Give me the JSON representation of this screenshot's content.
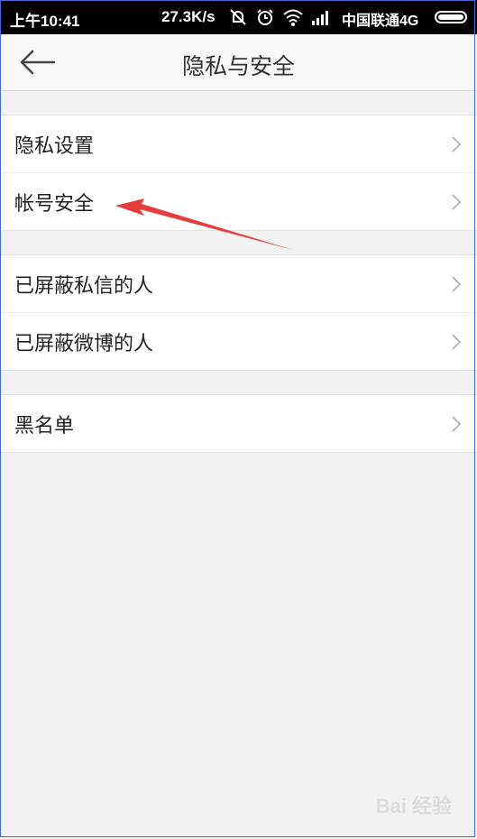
{
  "status_bar": {
    "time": "上午10:41",
    "speed": "27.3K/s",
    "carrier": "中国联通4G"
  },
  "header": {
    "title": "隐私与安全"
  },
  "groups": [
    {
      "items": [
        {
          "label": "隐私设置"
        },
        {
          "label": "帐号安全"
        }
      ]
    },
    {
      "items": [
        {
          "label": "已屏蔽私信的人"
        },
        {
          "label": "已屏蔽微博的人"
        }
      ]
    },
    {
      "items": [
        {
          "label": "黑名单"
        }
      ]
    }
  ],
  "annotation": {
    "arrow_color": "#e83b3b"
  },
  "watermark": {
    "text": "Bai 经验"
  },
  "colors": {
    "background": "#f2f2f2",
    "status_bar": "#000000",
    "header": "#f8f8f8"
  }
}
